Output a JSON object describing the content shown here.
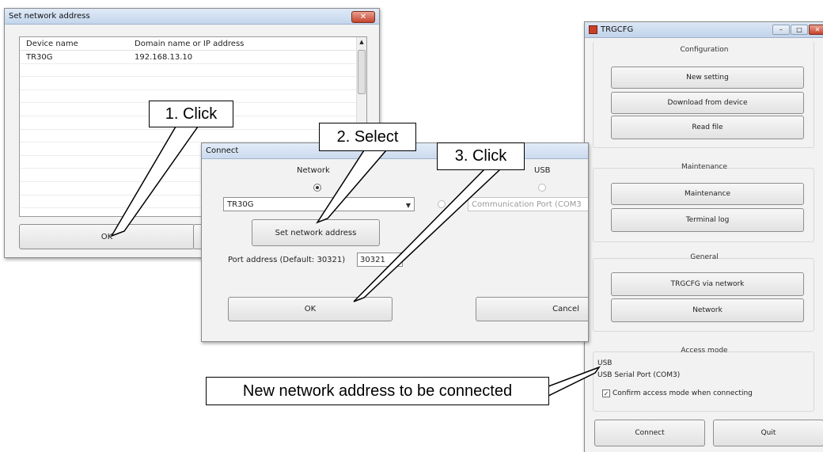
{
  "set_network_window": {
    "title": "Set network address",
    "close_glyph": "✕",
    "columns": [
      "Device name",
      "Domain name or IP address"
    ],
    "rows": [
      {
        "device": "TR30G",
        "address": "192.168.13.10"
      }
    ],
    "ok_label": "OK"
  },
  "connect_window": {
    "title": "Connect",
    "network_label": "Network",
    "usb_label": "USB",
    "network_selected": "TR30G",
    "usb_port": "Communication Port (COM3",
    "set_network_button": "Set network address",
    "port_label": "Port address (Default: 30321)",
    "port_value": "30321",
    "ok_label": "OK",
    "cancel_label": "Cancel"
  },
  "trgcfg_window": {
    "title": "TRGCFG",
    "configuration": {
      "title": "Configuration",
      "buttons": [
        "New setting",
        "Download from device",
        "Read file"
      ]
    },
    "maintenance": {
      "title": "Maintenance",
      "buttons": [
        "Maintenance",
        "Terminal log"
      ]
    },
    "general": {
      "title": "General",
      "buttons": [
        "TRGCFG via network",
        "Network"
      ]
    },
    "access_mode": {
      "title": "Access mode",
      "line1": "USB",
      "line2": "USB Serial Port (COM3)",
      "checkbox_label": "Confirm access mode when connecting",
      "checked": true
    },
    "connect_label": "Connect",
    "quit_label": "Quit"
  },
  "callouts": {
    "step1": "1. Click",
    "step2": "2. Select",
    "step3": "3. Click",
    "note": "New network address to be connected"
  }
}
